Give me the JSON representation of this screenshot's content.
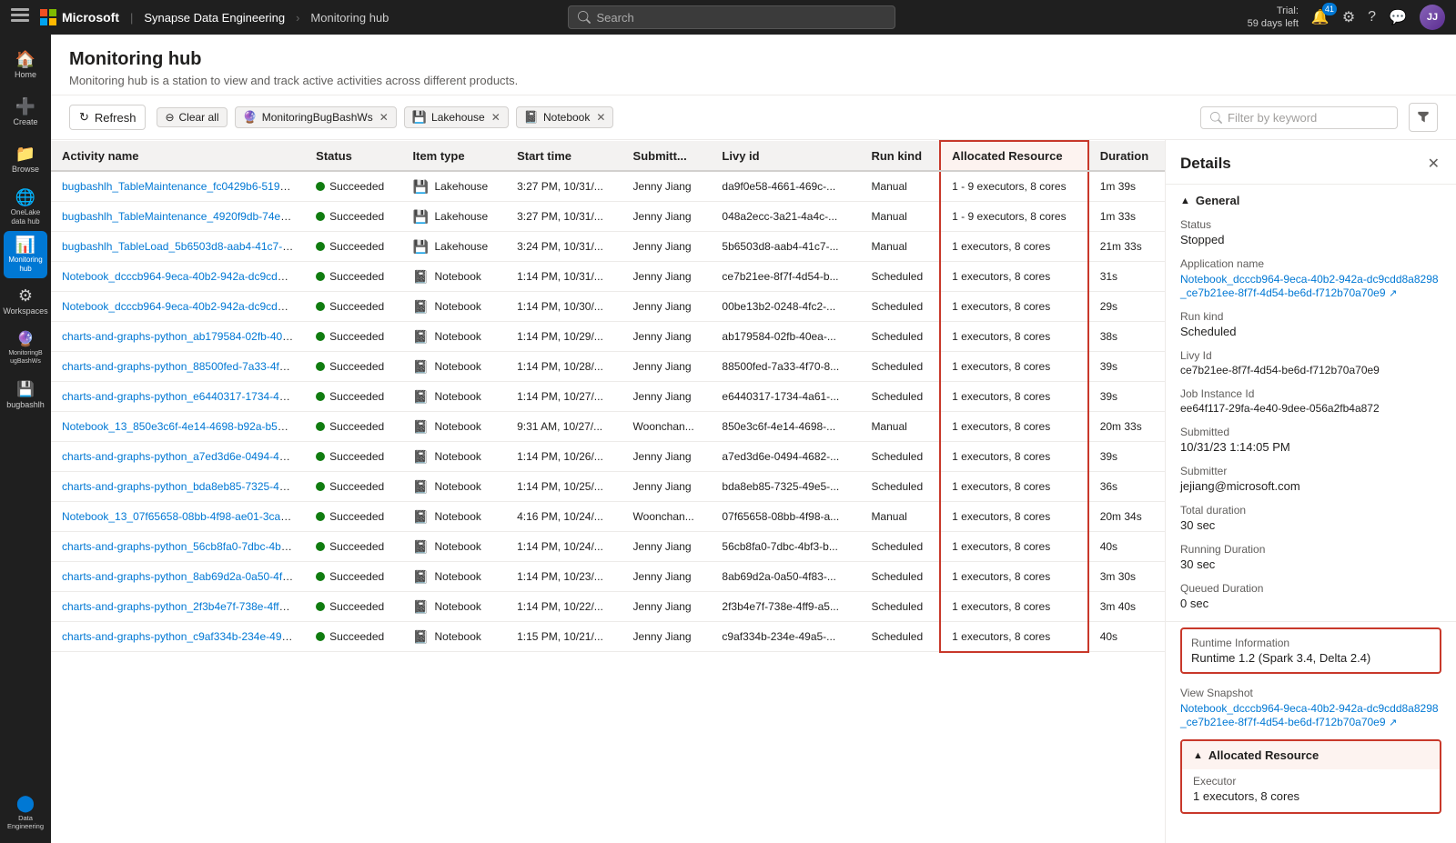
{
  "topbar": {
    "apps_label": "Apps",
    "microsoft_label": "Microsoft",
    "product_label": "Synapse Data Engineering",
    "breadcrumb": "Monitoring hub",
    "search_placeholder": "Search",
    "trial_line1": "Trial:",
    "trial_line2": "59 days left",
    "notification_count": "41"
  },
  "sidebar": {
    "items": [
      {
        "label": "Home",
        "icon": "🏠",
        "active": false
      },
      {
        "label": "Create",
        "icon": "➕",
        "active": false
      },
      {
        "label": "Browse",
        "icon": "📁",
        "active": false
      },
      {
        "label": "OneLake data hub",
        "icon": "🌐",
        "active": false
      },
      {
        "label": "Monitoring hub",
        "icon": "📊",
        "active": true
      },
      {
        "label": "Workspaces",
        "icon": "⚙",
        "active": false
      },
      {
        "label": "MonitoringBugBashWs",
        "icon": "🔮",
        "active": false
      },
      {
        "label": "bugbashlh",
        "icon": "💾",
        "active": false
      },
      {
        "label": "Data Engineering",
        "icon": "🔵",
        "active": false
      }
    ]
  },
  "page": {
    "title": "Monitoring hub",
    "subtitle": "Monitoring hub is a station to view and track active activities across different products."
  },
  "toolbar": {
    "refresh_label": "Refresh",
    "clear_all_label": "Clear all",
    "filter_tags": [
      {
        "icon": "🔮",
        "label": "MonitoringBugBashWs"
      },
      {
        "icon": "💾",
        "label": "Lakehouse"
      },
      {
        "icon": "📓",
        "label": "Notebook"
      }
    ],
    "search_placeholder": "Filter by keyword"
  },
  "table": {
    "columns": [
      "Activity name",
      "Status",
      "Item type",
      "Start time",
      "Submitt...",
      "Livy id",
      "Run kind",
      "Allocated Resource",
      "Duration"
    ],
    "rows": [
      {
        "activity": "bugbashlh_TableMaintenance_fc0429b6-5197-4...",
        "status": "Succeeded",
        "item_type": "Lakehouse",
        "start_time": "3:27 PM, 10/31/...",
        "submitted": "Jenny Jiang",
        "livy_id": "da9f0e58-4661-469c-...",
        "run_kind": "Manual",
        "alloc": "1 - 9 executors, 8 cores",
        "duration": "1m 39s"
      },
      {
        "activity": "bugbashlh_TableMaintenance_4920f9db-74e9-4...",
        "status": "Succeeded",
        "item_type": "Lakehouse",
        "start_time": "3:27 PM, 10/31/...",
        "submitted": "Jenny Jiang",
        "livy_id": "048a2ecc-3a21-4a4c-...",
        "run_kind": "Manual",
        "alloc": "1 - 9 executors, 8 cores",
        "duration": "1m 33s"
      },
      {
        "activity": "bugbashlh_TableLoad_5b6503d8-aab4-41c7-9b...",
        "status": "Succeeded",
        "item_type": "Lakehouse",
        "start_time": "3:24 PM, 10/31/...",
        "submitted": "Jenny Jiang",
        "livy_id": "5b6503d8-aab4-41c7-...",
        "run_kind": "Manual",
        "alloc": "1 executors, 8 cores",
        "duration": "21m 33s"
      },
      {
        "activity": "Notebook_dcccb964-9eca-40b2-942a-dc9cdd8a...",
        "status": "Succeeded",
        "item_type": "Notebook",
        "start_time": "1:14 PM, 10/31/...",
        "submitted": "Jenny Jiang",
        "livy_id": "ce7b21ee-8f7f-4d54-b...",
        "run_kind": "Scheduled",
        "alloc": "1 executors, 8 cores",
        "duration": "31s"
      },
      {
        "activity": "Notebook_dcccb964-9eca-40b2-942a-dc9cdd8a...",
        "status": "Succeeded",
        "item_type": "Notebook",
        "start_time": "1:14 PM, 10/30/...",
        "submitted": "Jenny Jiang",
        "livy_id": "00be13b2-0248-4fc2-...",
        "run_kind": "Scheduled",
        "alloc": "1 executors, 8 cores",
        "duration": "29s"
      },
      {
        "activity": "charts-and-graphs-python_ab179584-02fb-40ea...",
        "status": "Succeeded",
        "item_type": "Notebook",
        "start_time": "1:14 PM, 10/29/...",
        "submitted": "Jenny Jiang",
        "livy_id": "ab179584-02fb-40ea-...",
        "run_kind": "Scheduled",
        "alloc": "1 executors, 8 cores",
        "duration": "38s"
      },
      {
        "activity": "charts-and-graphs-python_88500fed-7a33-4f70...",
        "status": "Succeeded",
        "item_type": "Notebook",
        "start_time": "1:14 PM, 10/28/...",
        "submitted": "Jenny Jiang",
        "livy_id": "88500fed-7a33-4f70-8...",
        "run_kind": "Scheduled",
        "alloc": "1 executors, 8 cores",
        "duration": "39s"
      },
      {
        "activity": "charts-and-graphs-python_e6440317-1734-4a6...",
        "status": "Succeeded",
        "item_type": "Notebook",
        "start_time": "1:14 PM, 10/27/...",
        "submitted": "Jenny Jiang",
        "livy_id": "e6440317-1734-4a61-...",
        "run_kind": "Scheduled",
        "alloc": "1 executors, 8 cores",
        "duration": "39s"
      },
      {
        "activity": "Notebook_13_850e3c6f-4e14-4698-b92a-b5e6e...",
        "status": "Succeeded",
        "item_type": "Notebook",
        "start_time": "9:31 AM, 10/27/...",
        "submitted": "Woonchan...",
        "livy_id": "850e3c6f-4e14-4698-...",
        "run_kind": "Manual",
        "alloc": "1 executors, 8 cores",
        "duration": "20m 33s"
      },
      {
        "activity": "charts-and-graphs-python_a7ed3d6e-0494-468...",
        "status": "Succeeded",
        "item_type": "Notebook",
        "start_time": "1:14 PM, 10/26/...",
        "submitted": "Jenny Jiang",
        "livy_id": "a7ed3d6e-0494-4682-...",
        "run_kind": "Scheduled",
        "alloc": "1 executors, 8 cores",
        "duration": "39s"
      },
      {
        "activity": "charts-and-graphs-python_bda8eb85-7325-49e...",
        "status": "Succeeded",
        "item_type": "Notebook",
        "start_time": "1:14 PM, 10/25/...",
        "submitted": "Jenny Jiang",
        "livy_id": "bda8eb85-7325-49e5-...",
        "run_kind": "Scheduled",
        "alloc": "1 executors, 8 cores",
        "duration": "36s"
      },
      {
        "activity": "Notebook_13_07f65658-08bb-4f98-ae01-3ca683...",
        "status": "Succeeded",
        "item_type": "Notebook",
        "start_time": "4:16 PM, 10/24/...",
        "submitted": "Woonchan...",
        "livy_id": "07f65658-08bb-4f98-a...",
        "run_kind": "Manual",
        "alloc": "1 executors, 8 cores",
        "duration": "20m 34s"
      },
      {
        "activity": "charts-and-graphs-python_56cb8fa0-7dbc-4bf3...",
        "status": "Succeeded",
        "item_type": "Notebook",
        "start_time": "1:14 PM, 10/24/...",
        "submitted": "Jenny Jiang",
        "livy_id": "56cb8fa0-7dbc-4bf3-b...",
        "run_kind": "Scheduled",
        "alloc": "1 executors, 8 cores",
        "duration": "40s"
      },
      {
        "activity": "charts-and-graphs-python_8ab69d2a-0a50-4f83...",
        "status": "Succeeded",
        "item_type": "Notebook",
        "start_time": "1:14 PM, 10/23/...",
        "submitted": "Jenny Jiang",
        "livy_id": "8ab69d2a-0a50-4f83-...",
        "run_kind": "Scheduled",
        "alloc": "1 executors, 8 cores",
        "duration": "3m 30s"
      },
      {
        "activity": "charts-and-graphs-python_2f3b4e7f-738e-4ff9-...",
        "status": "Succeeded",
        "item_type": "Notebook",
        "start_time": "1:14 PM, 10/22/...",
        "submitted": "Jenny Jiang",
        "livy_id": "2f3b4e7f-738e-4ff9-a5...",
        "run_kind": "Scheduled",
        "alloc": "1 executors, 8 cores",
        "duration": "3m 40s"
      },
      {
        "activity": "charts-and-graphs-python_c9af334b-234e-49a5...",
        "status": "Succeeded",
        "item_type": "Notebook",
        "start_time": "1:15 PM, 10/21/...",
        "submitted": "Jenny Jiang",
        "livy_id": "c9af334b-234e-49a5-...",
        "run_kind": "Scheduled",
        "alloc": "1 executors, 8 cores",
        "duration": "40s"
      }
    ]
  },
  "details": {
    "title": "Details",
    "close_label": "✕",
    "general_section": "General",
    "fields": {
      "status_label": "Status",
      "status_value": "Stopped",
      "app_name_label": "Application name",
      "app_name_value": "Notebook_dcccb964-9eca-40b2-942a-dc9cdd8a8298_ce7b21ee-8f7f-4d54-be6d-f712b70a70e9",
      "run_kind_label": "Run kind",
      "run_kind_value": "Scheduled",
      "livy_id_label": "Livy Id",
      "livy_id_value": "ce7b21ee-8f7f-4d54-be6d-f712b70a70e9",
      "job_instance_label": "Job Instance Id",
      "job_instance_value": "ee64f117-29fa-4e40-9dee-056a2fb4a872",
      "submitted_label": "Submitted",
      "submitted_value": "10/31/23 1:14:05 PM",
      "submitter_label": "Submitter",
      "submitter_value": "jejiang@microsoft.com",
      "total_duration_label": "Total duration",
      "total_duration_value": "30 sec",
      "running_duration_label": "Running Duration",
      "running_duration_value": "30 sec",
      "queued_duration_label": "Queued Duration",
      "queued_duration_value": "0 sec",
      "runtime_label": "Runtime Information",
      "runtime_value": "Runtime 1.2 (Spark 3.4, Delta 2.4)",
      "view_snapshot_label": "View Snapshot",
      "view_snapshot_value": "Notebook_dcccb964-9eca-40b2-942a-dc9cdd8a8298_ce7b21ee-8f7f-4d54-be6d-f712b70a70e9",
      "alloc_section": "Allocated Resource",
      "executor_label": "Executor",
      "executor_value": "1 executors, 8 cores"
    }
  }
}
